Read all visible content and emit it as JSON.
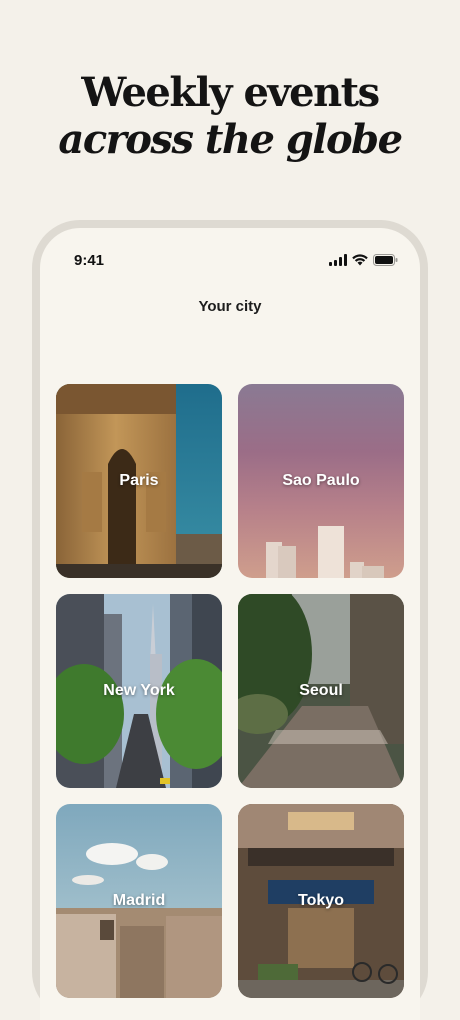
{
  "headline": {
    "line1": "Weekly events",
    "line2": "across the globe"
  },
  "status_bar": {
    "time": "9:41",
    "icons": [
      "signal-icon",
      "wifi-icon",
      "battery-icon"
    ]
  },
  "screen_title": "Your city",
  "cities": [
    {
      "label": "Paris"
    },
    {
      "label": "Sao Paulo"
    },
    {
      "label": "New York"
    },
    {
      "label": "Seoul"
    },
    {
      "label": "Madrid"
    },
    {
      "label": "Tokyo"
    }
  ]
}
